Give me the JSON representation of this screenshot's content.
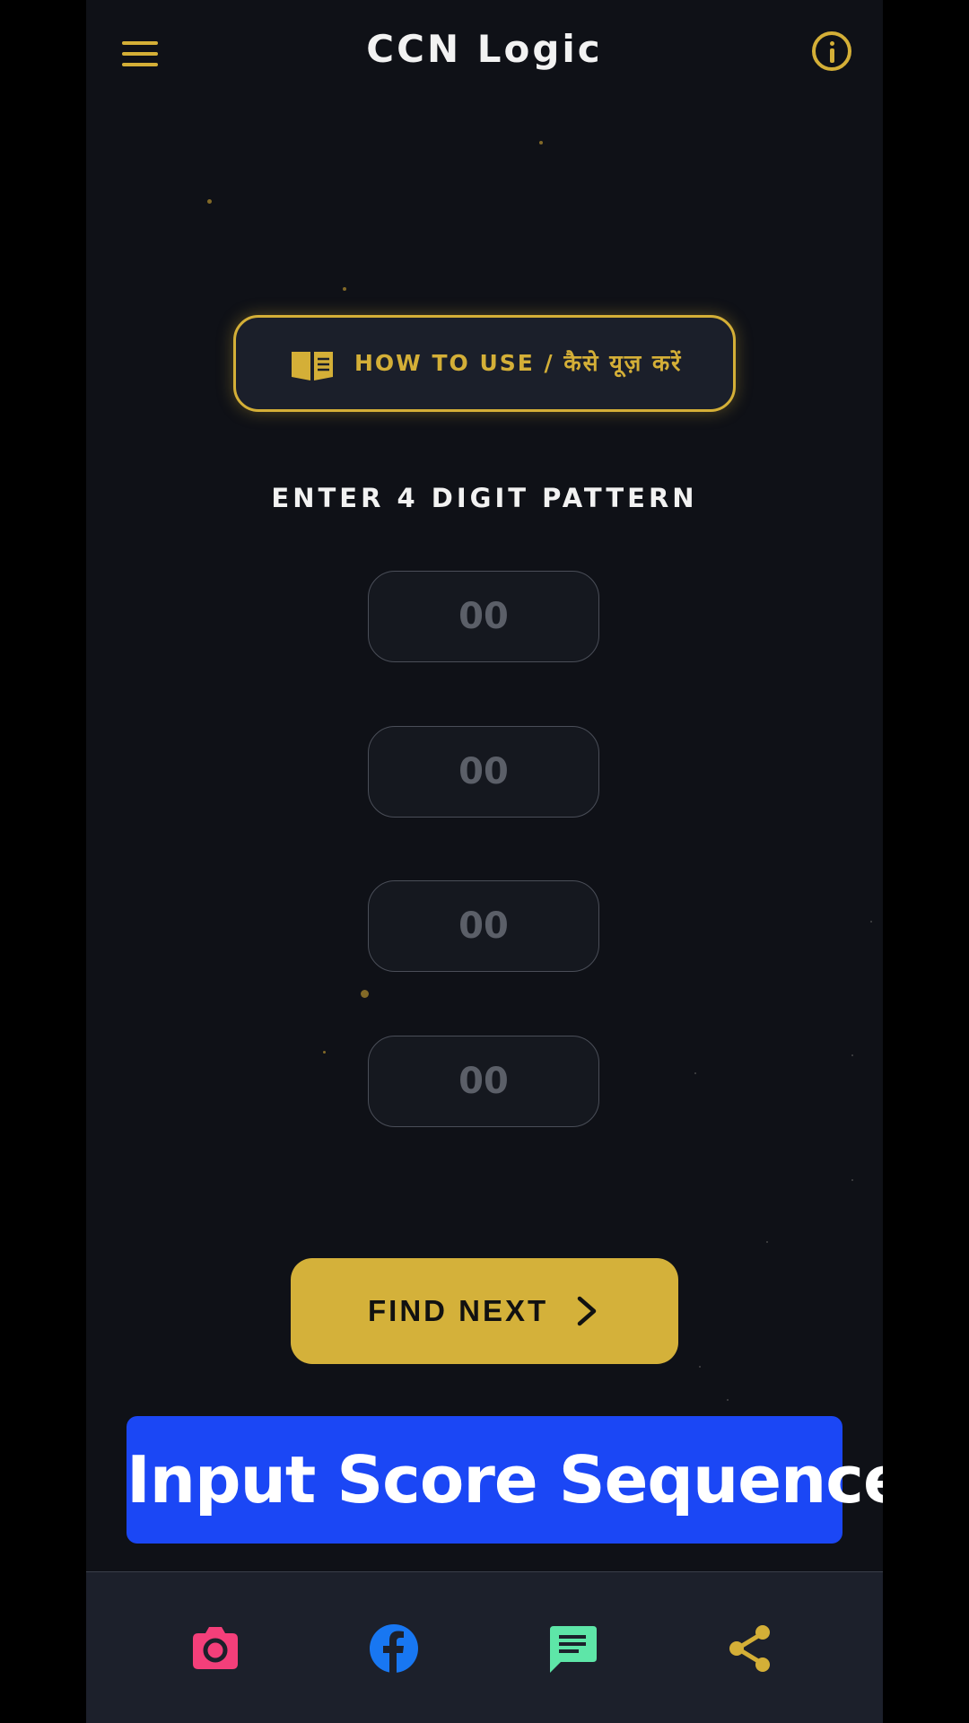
{
  "header": {
    "title": "CCN Logic"
  },
  "howto": {
    "label": "HOW TO USE / कैसे यूज़ करें"
  },
  "pattern": {
    "label": "ENTER 4 DIGIT PATTERN",
    "inputs": [
      {
        "placeholder": "00",
        "value": ""
      },
      {
        "placeholder": "00",
        "value": ""
      },
      {
        "placeholder": "00",
        "value": ""
      },
      {
        "placeholder": "00",
        "value": ""
      }
    ]
  },
  "find": {
    "label": "FIND NEXT"
  },
  "banner": {
    "text": "Input Score Sequence"
  },
  "colors": {
    "accent": "#d4af37",
    "background": "#0f1117",
    "banner": "#1b47f5",
    "instagram": "#f43f7a",
    "facebook": "#1877f2",
    "chat": "#5ee6a8"
  },
  "nav": {
    "icons": [
      "camera-icon",
      "facebook-icon",
      "chat-icon",
      "share-icon"
    ]
  }
}
